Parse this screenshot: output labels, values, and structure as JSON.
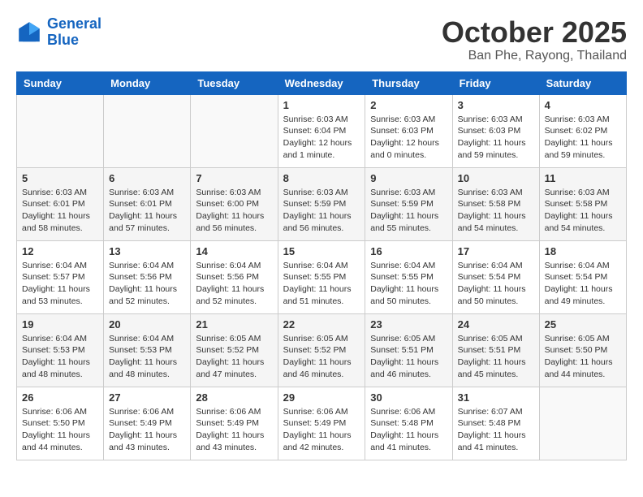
{
  "header": {
    "logo_line1": "General",
    "logo_line2": "Blue",
    "month": "October 2025",
    "location": "Ban Phe, Rayong, Thailand"
  },
  "weekdays": [
    "Sunday",
    "Monday",
    "Tuesday",
    "Wednesday",
    "Thursday",
    "Friday",
    "Saturday"
  ],
  "weeks": [
    [
      {
        "day": "",
        "info": ""
      },
      {
        "day": "",
        "info": ""
      },
      {
        "day": "",
        "info": ""
      },
      {
        "day": "1",
        "info": "Sunrise: 6:03 AM\nSunset: 6:04 PM\nDaylight: 12 hours\nand 1 minute."
      },
      {
        "day": "2",
        "info": "Sunrise: 6:03 AM\nSunset: 6:03 PM\nDaylight: 12 hours\nand 0 minutes."
      },
      {
        "day": "3",
        "info": "Sunrise: 6:03 AM\nSunset: 6:03 PM\nDaylight: 11 hours\nand 59 minutes."
      },
      {
        "day": "4",
        "info": "Sunrise: 6:03 AM\nSunset: 6:02 PM\nDaylight: 11 hours\nand 59 minutes."
      }
    ],
    [
      {
        "day": "5",
        "info": "Sunrise: 6:03 AM\nSunset: 6:01 PM\nDaylight: 11 hours\nand 58 minutes."
      },
      {
        "day": "6",
        "info": "Sunrise: 6:03 AM\nSunset: 6:01 PM\nDaylight: 11 hours\nand 57 minutes."
      },
      {
        "day": "7",
        "info": "Sunrise: 6:03 AM\nSunset: 6:00 PM\nDaylight: 11 hours\nand 56 minutes."
      },
      {
        "day": "8",
        "info": "Sunrise: 6:03 AM\nSunset: 5:59 PM\nDaylight: 11 hours\nand 56 minutes."
      },
      {
        "day": "9",
        "info": "Sunrise: 6:03 AM\nSunset: 5:59 PM\nDaylight: 11 hours\nand 55 minutes."
      },
      {
        "day": "10",
        "info": "Sunrise: 6:03 AM\nSunset: 5:58 PM\nDaylight: 11 hours\nand 54 minutes."
      },
      {
        "day": "11",
        "info": "Sunrise: 6:03 AM\nSunset: 5:58 PM\nDaylight: 11 hours\nand 54 minutes."
      }
    ],
    [
      {
        "day": "12",
        "info": "Sunrise: 6:04 AM\nSunset: 5:57 PM\nDaylight: 11 hours\nand 53 minutes."
      },
      {
        "day": "13",
        "info": "Sunrise: 6:04 AM\nSunset: 5:56 PM\nDaylight: 11 hours\nand 52 minutes."
      },
      {
        "day": "14",
        "info": "Sunrise: 6:04 AM\nSunset: 5:56 PM\nDaylight: 11 hours\nand 52 minutes."
      },
      {
        "day": "15",
        "info": "Sunrise: 6:04 AM\nSunset: 5:55 PM\nDaylight: 11 hours\nand 51 minutes."
      },
      {
        "day": "16",
        "info": "Sunrise: 6:04 AM\nSunset: 5:55 PM\nDaylight: 11 hours\nand 50 minutes."
      },
      {
        "day": "17",
        "info": "Sunrise: 6:04 AM\nSunset: 5:54 PM\nDaylight: 11 hours\nand 50 minutes."
      },
      {
        "day": "18",
        "info": "Sunrise: 6:04 AM\nSunset: 5:54 PM\nDaylight: 11 hours\nand 49 minutes."
      }
    ],
    [
      {
        "day": "19",
        "info": "Sunrise: 6:04 AM\nSunset: 5:53 PM\nDaylight: 11 hours\nand 48 minutes."
      },
      {
        "day": "20",
        "info": "Sunrise: 6:04 AM\nSunset: 5:53 PM\nDaylight: 11 hours\nand 48 minutes."
      },
      {
        "day": "21",
        "info": "Sunrise: 6:05 AM\nSunset: 5:52 PM\nDaylight: 11 hours\nand 47 minutes."
      },
      {
        "day": "22",
        "info": "Sunrise: 6:05 AM\nSunset: 5:52 PM\nDaylight: 11 hours\nand 46 minutes."
      },
      {
        "day": "23",
        "info": "Sunrise: 6:05 AM\nSunset: 5:51 PM\nDaylight: 11 hours\nand 46 minutes."
      },
      {
        "day": "24",
        "info": "Sunrise: 6:05 AM\nSunset: 5:51 PM\nDaylight: 11 hours\nand 45 minutes."
      },
      {
        "day": "25",
        "info": "Sunrise: 6:05 AM\nSunset: 5:50 PM\nDaylight: 11 hours\nand 44 minutes."
      }
    ],
    [
      {
        "day": "26",
        "info": "Sunrise: 6:06 AM\nSunset: 5:50 PM\nDaylight: 11 hours\nand 44 minutes."
      },
      {
        "day": "27",
        "info": "Sunrise: 6:06 AM\nSunset: 5:49 PM\nDaylight: 11 hours\nand 43 minutes."
      },
      {
        "day": "28",
        "info": "Sunrise: 6:06 AM\nSunset: 5:49 PM\nDaylight: 11 hours\nand 43 minutes."
      },
      {
        "day": "29",
        "info": "Sunrise: 6:06 AM\nSunset: 5:49 PM\nDaylight: 11 hours\nand 42 minutes."
      },
      {
        "day": "30",
        "info": "Sunrise: 6:06 AM\nSunset: 5:48 PM\nDaylight: 11 hours\nand 41 minutes."
      },
      {
        "day": "31",
        "info": "Sunrise: 6:07 AM\nSunset: 5:48 PM\nDaylight: 11 hours\nand 41 minutes."
      },
      {
        "day": "",
        "info": ""
      }
    ]
  ]
}
